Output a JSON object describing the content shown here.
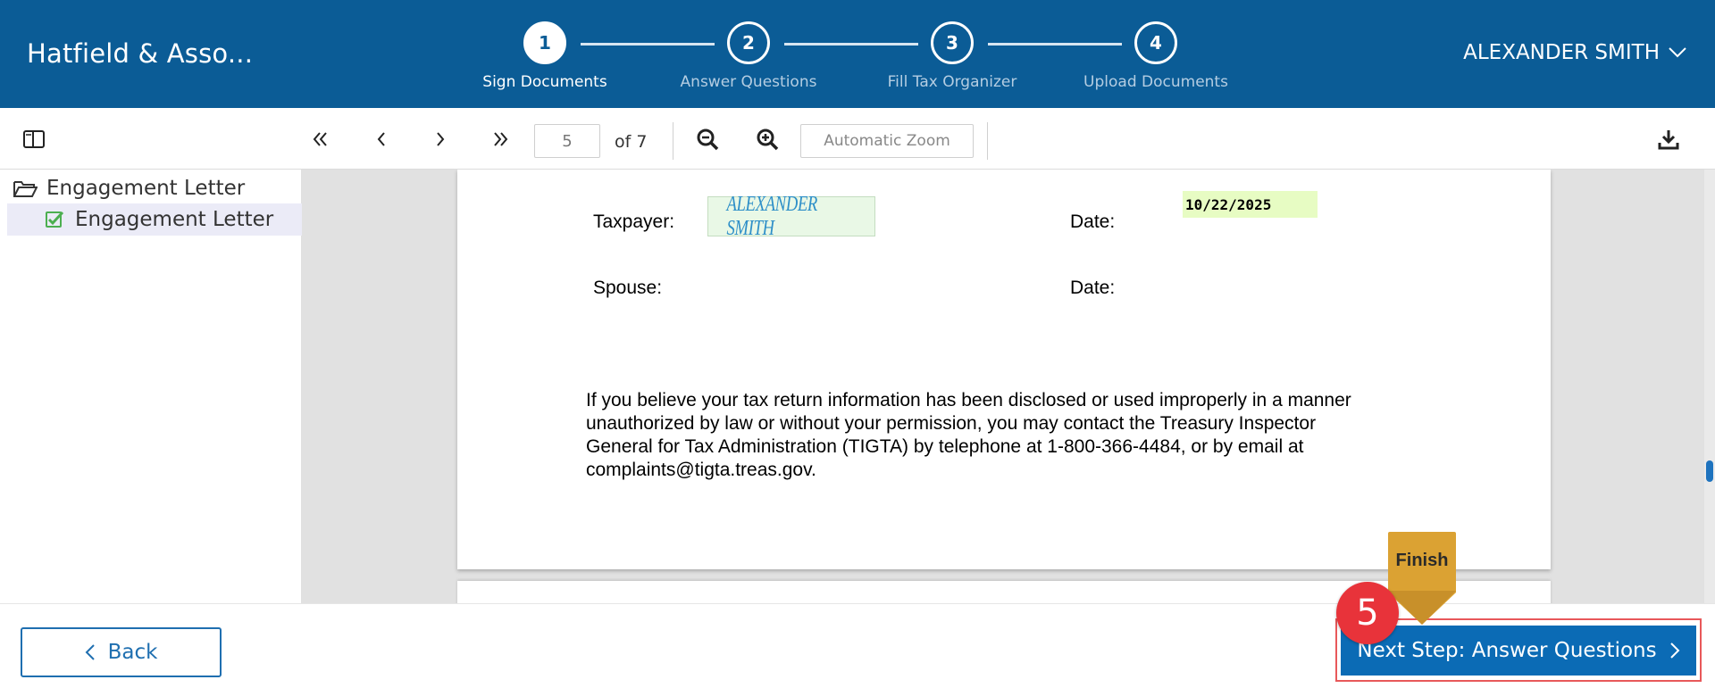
{
  "header": {
    "brand": "Hatfield & Asso...",
    "user_name": "ALEXANDER SMITH",
    "steps": [
      {
        "number": "1",
        "label": "Sign Documents",
        "active": true
      },
      {
        "number": "2",
        "label": "Answer Questions",
        "active": false
      },
      {
        "number": "3",
        "label": "Fill Tax Organizer",
        "active": false
      },
      {
        "number": "4",
        "label": "Upload Documents",
        "active": false
      }
    ]
  },
  "toolbar": {
    "current_page": "5",
    "total_pages_label": "of 7",
    "zoom_label": "Automatic Zoom",
    "icons": [
      "sidebar-toggle-icon",
      "first-page-icon",
      "previous-page-icon",
      "next-page-icon",
      "last-page-icon",
      "zoom-out-icon",
      "zoom-in-icon",
      "download-icon"
    ]
  },
  "sidebar": {
    "folder_label": "Engagement Letter",
    "item_label": "Engagement Letter"
  },
  "document": {
    "taxpayer_label": "Taxpayer:",
    "taxpayer_signature": "ALEXANDER SMITH",
    "date_label_1": "Date:",
    "date_value": "10/22/2025",
    "spouse_label": "Spouse:",
    "date_label_2": "Date:",
    "paragraph_lines": [
      "If you believe your tax return information has been disclosed or used improperly in a manner",
      "unauthorized by law or without your permission, you may contact the Treasury Inspector",
      "General for Tax Administration (TIGTA) by telephone at 1-800-366-4484, or by email at",
      "complaints@tigta.treas.gov."
    ]
  },
  "footer": {
    "back_label": "Back",
    "next_label": "Next Step: Answer Questions",
    "badge": "5",
    "finish_label": "Finish"
  },
  "colors": {
    "header_bg": "#0b5c96",
    "primary_button": "#0b6bb5",
    "badge": "#e8333a",
    "finish_tag": "#dba233",
    "signature_bg": "#e9f8e6",
    "date_bg": "#e7fcc3"
  }
}
